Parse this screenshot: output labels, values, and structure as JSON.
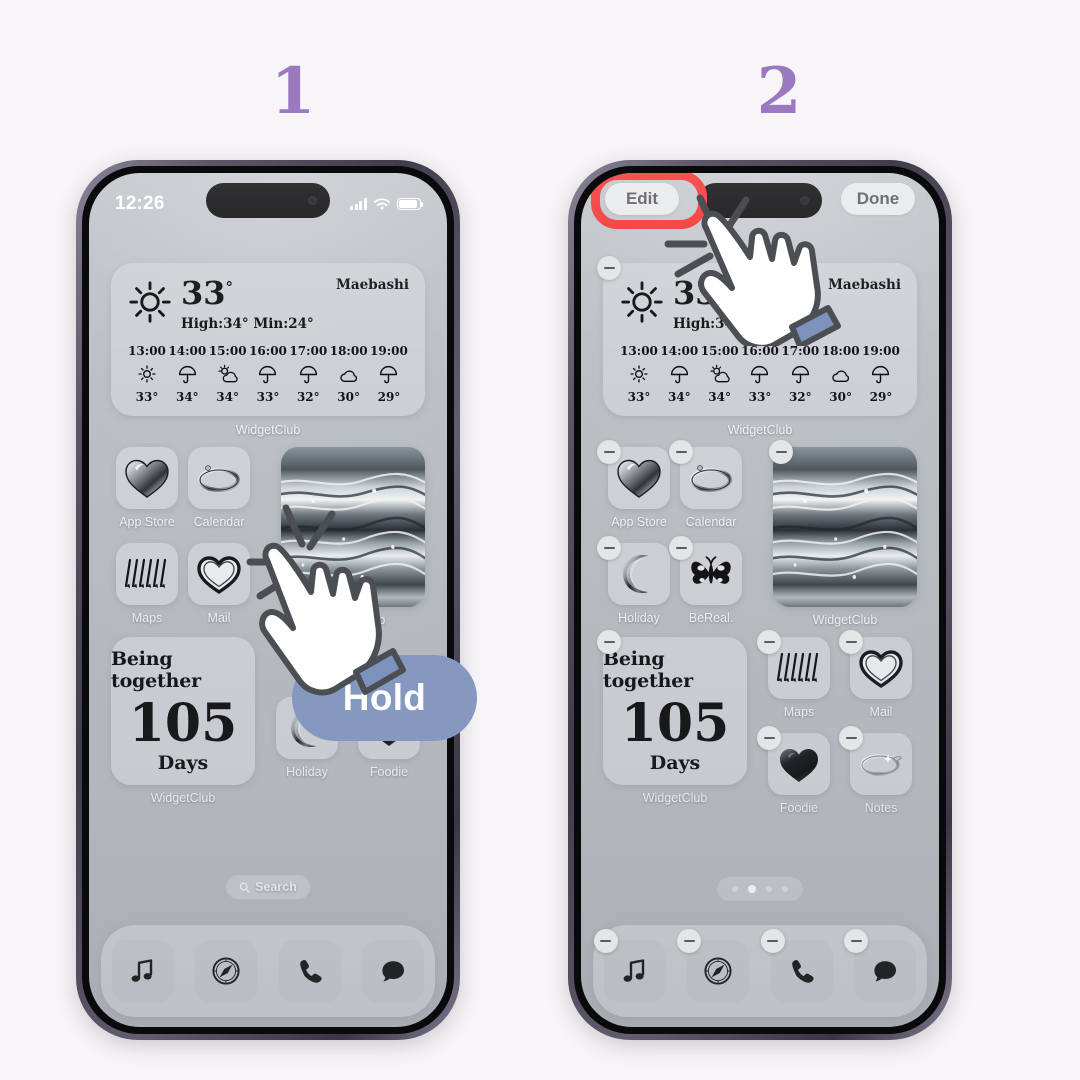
{
  "steps": [
    {
      "number": "1"
    },
    {
      "number": "2"
    }
  ],
  "phone1": {
    "status": {
      "time": "12:26",
      "cellular_icon": "signal-bars-icon",
      "wifi_icon": "wifi-icon",
      "battery_icon": "battery-icon"
    },
    "weather_widget": {
      "condition_icon": "sun-icon",
      "temperature": "33",
      "degree": "°",
      "high_low": "High:34° Min:24°",
      "city": "Maebashi",
      "hours": [
        {
          "time": "13:00",
          "icon": "sun-small-icon",
          "temp": "33°"
        },
        {
          "time": "14:00",
          "icon": "umbrella-icon",
          "temp": "34°"
        },
        {
          "time": "15:00",
          "icon": "sun-cloud-icon",
          "temp": "34°"
        },
        {
          "time": "16:00",
          "icon": "umbrella-icon",
          "temp": "33°"
        },
        {
          "time": "17:00",
          "icon": "umbrella-icon",
          "temp": "32°"
        },
        {
          "time": "18:00",
          "icon": "cloud-icon",
          "temp": "30°"
        },
        {
          "time": "19:00",
          "icon": "umbrella-icon",
          "temp": "29°"
        }
      ],
      "label": "WidgetClub"
    },
    "apps_row1": [
      {
        "label": "App Store",
        "icon": "chrome-heart-icon"
      },
      {
        "label": "Calendar",
        "icon": "chrome-ring-icon"
      }
    ],
    "apps_row2": [
      {
        "label": "Maps",
        "icon": "arrows-icon"
      },
      {
        "label": "Mail",
        "icon": "outline-heart-icon"
      }
    ],
    "marble_widget": {
      "label": "WidgetClub",
      "icon": "marble-photo"
    },
    "days_widget": {
      "title": "Being together",
      "number": "105",
      "unit": "Days",
      "label": "WidgetClub"
    },
    "apps_row3": [
      {
        "label": "Holiday",
        "icon": "crescent-moon-icon"
      },
      {
        "label": "Foodie",
        "icon": "black-heart-icon"
      }
    ],
    "search": {
      "label": "Search",
      "icon": "search-icon"
    },
    "dock": [
      {
        "name": "music",
        "icon": "music-note-icon"
      },
      {
        "name": "safari",
        "icon": "compass-icon"
      },
      {
        "name": "phone",
        "icon": "phone-handset-icon"
      },
      {
        "name": "messages",
        "icon": "speech-bubble-icon"
      }
    ],
    "gesture": {
      "label": "Hold",
      "icon": "hand-pointer-icon",
      "color": "#8498C0"
    }
  },
  "phone2": {
    "topbar": {
      "edit_label": "Edit",
      "done_label": "Done",
      "highlight_color": "#F4312F"
    },
    "weather_widget": {
      "condition_icon": "sun-icon",
      "temperature": "33",
      "degree": "°",
      "high_low": "High:34",
      "city": "Maebashi",
      "hours": [
        {
          "time": "13:00",
          "icon": "sun-small-icon",
          "temp": "33°"
        },
        {
          "time": "14:00",
          "icon": "umbrella-icon",
          "temp": "34°"
        },
        {
          "time": "15:00",
          "icon": "sun-cloud-icon",
          "temp": "34°"
        },
        {
          "time": "16:00",
          "icon": "umbrella-icon",
          "temp": "33°"
        },
        {
          "time": "17:00",
          "icon": "umbrella-icon",
          "temp": "32°"
        },
        {
          "time": "18:00",
          "icon": "cloud-icon",
          "temp": "30°"
        },
        {
          "time": "19:00",
          "icon": "umbrella-icon",
          "temp": "29°"
        }
      ],
      "label": "WidgetClub"
    },
    "apps_row1": [
      {
        "label": "App Store",
        "icon": "chrome-heart-icon"
      },
      {
        "label": "Calendar",
        "icon": "chrome-ring-icon"
      }
    ],
    "apps_row2": [
      {
        "label": "Holiday",
        "icon": "crescent-moon-icon"
      },
      {
        "label": "BeReal.",
        "icon": "butterfly-icon"
      }
    ],
    "marble_widget": {
      "label": "WidgetClub",
      "icon": "marble-photo"
    },
    "days_widget": {
      "title": "Being together",
      "number": "105",
      "unit": "Days",
      "label": "WidgetClub"
    },
    "apps_right_row1": [
      {
        "label": "Maps",
        "icon": "arrows-icon"
      },
      {
        "label": "Mail",
        "icon": "outline-heart-icon"
      }
    ],
    "apps_right_row2": [
      {
        "label": "Foodie",
        "icon": "black-heart-icon"
      },
      {
        "label": "Notes",
        "icon": "chrome-fish-icon"
      }
    ],
    "page_dots": {
      "count": 4,
      "active_index": 1
    },
    "dock": [
      {
        "name": "music",
        "icon": "music-note-icon"
      },
      {
        "name": "safari",
        "icon": "compass-icon"
      },
      {
        "name": "phone",
        "icon": "phone-handset-icon"
      },
      {
        "name": "messages",
        "icon": "speech-bubble-icon"
      }
    ],
    "remove_badge_icon": "minus-badge-icon"
  },
  "colors": {
    "page_background": "#F7F5F7",
    "step_number": "#9B79C0",
    "screen_background": "#BEC3C7",
    "widget_panel": "#D0D4D8",
    "hold_button": "#8498C0",
    "highlight_red": "#F4312F"
  }
}
